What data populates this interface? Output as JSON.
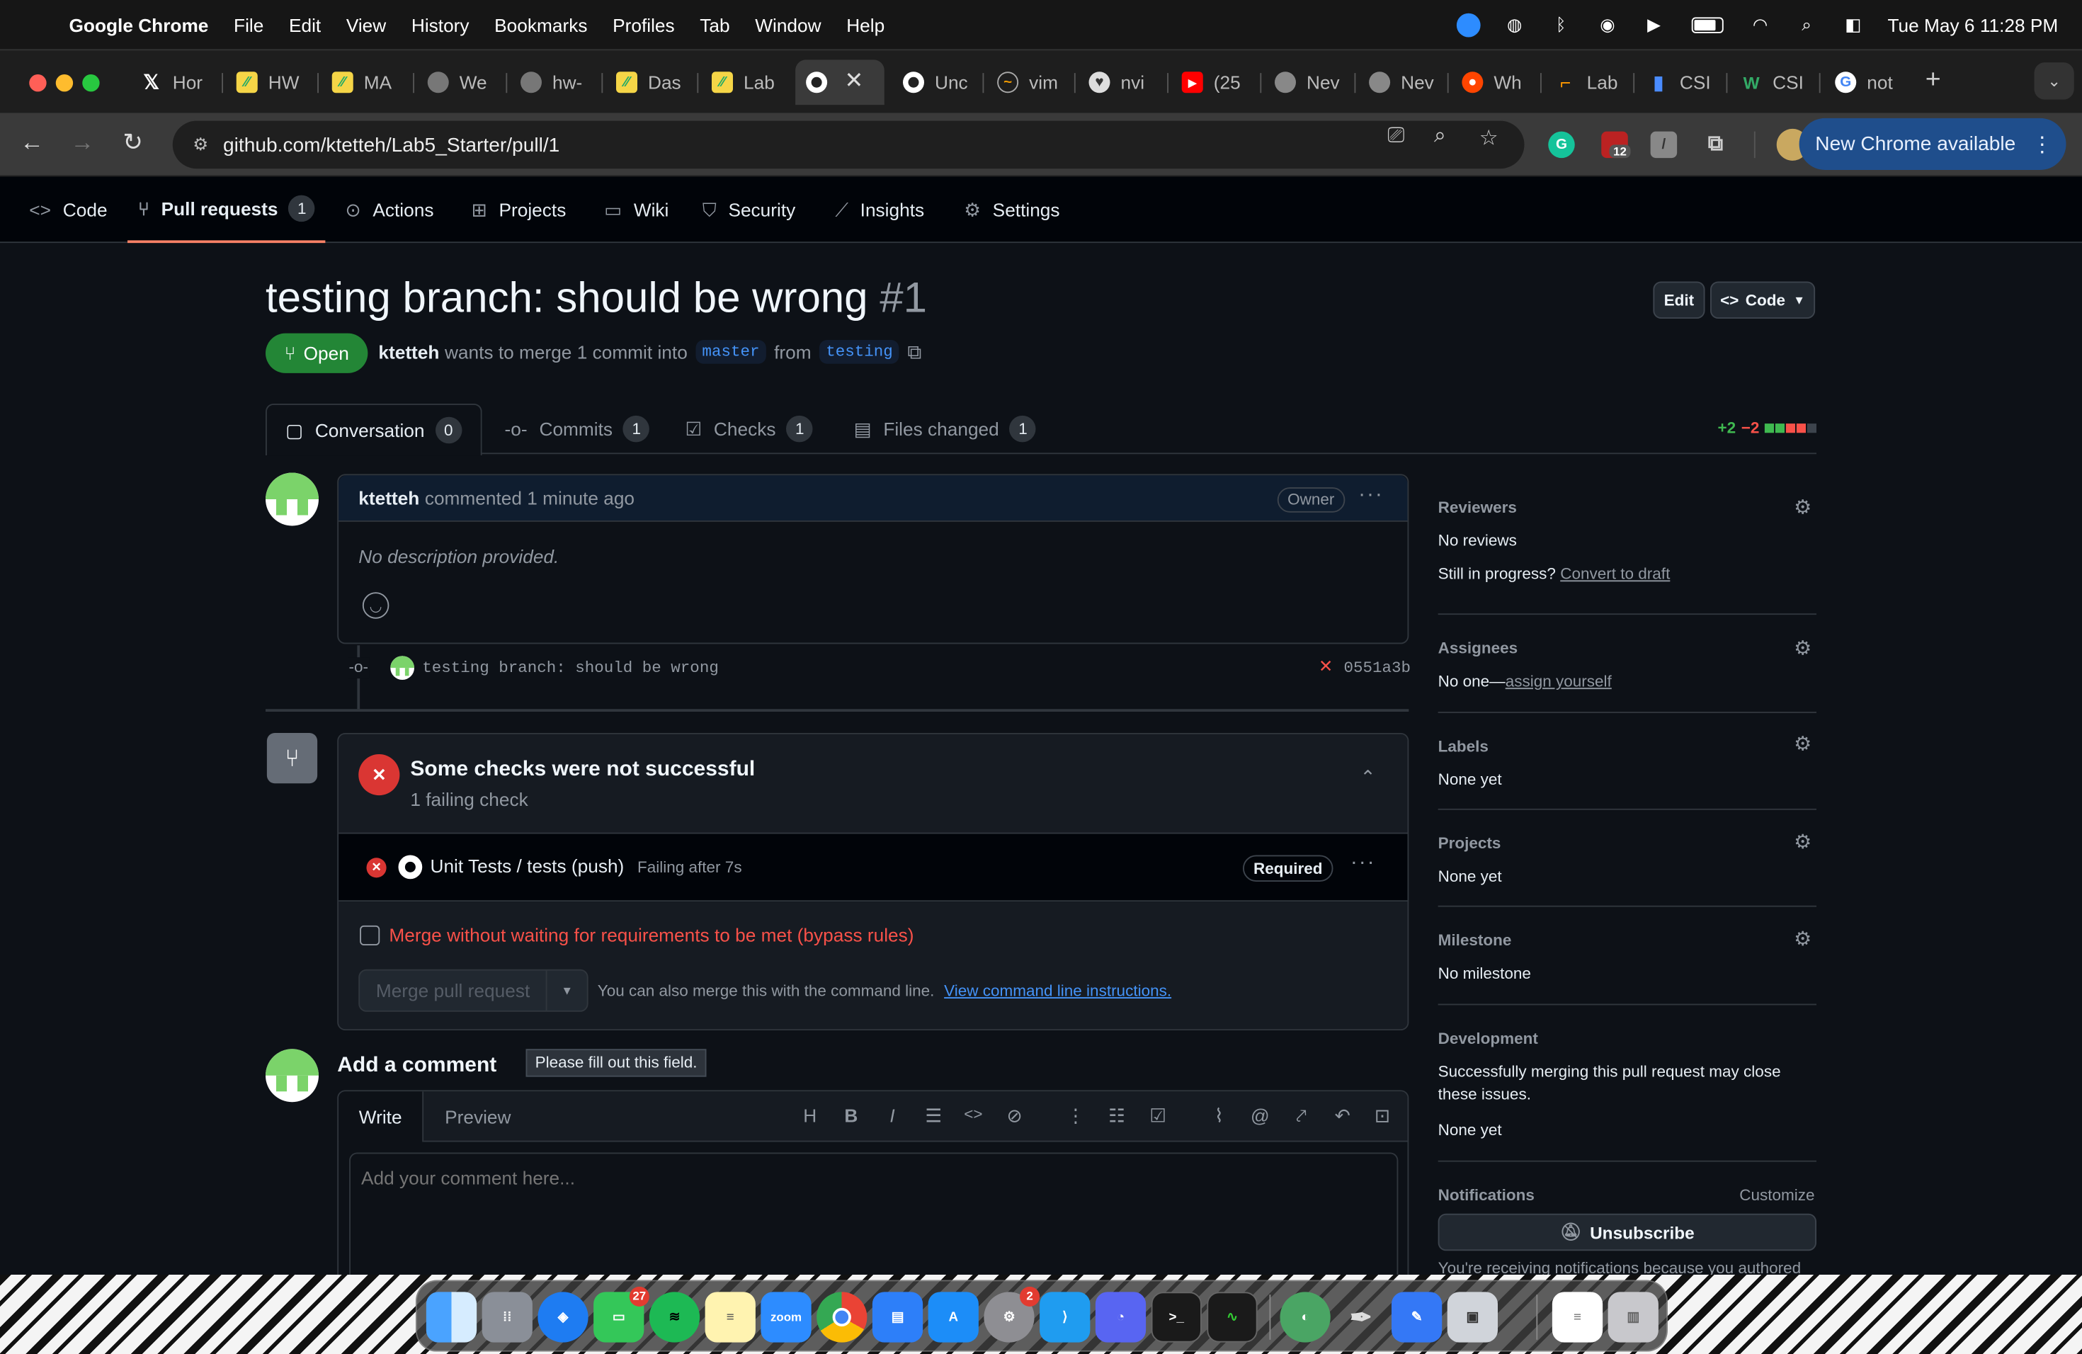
{
  "menubar": {
    "app_name": "Google Chrome",
    "items": [
      "File",
      "Edit",
      "View",
      "History",
      "Bookmarks",
      "Profiles",
      "Tab",
      "Window",
      "Help"
    ],
    "clock": "Tue May 6  11:28 PM",
    "status_icons": [
      "zoom-icon",
      "vpn-icon",
      "bluetooth-icon",
      "airdrop-icon",
      "play-icon",
      "battery-icon",
      "wifi-icon",
      "spotlight-icon",
      "control-center-icon"
    ]
  },
  "tabs": [
    {
      "title": "Hor",
      "icon": "x-icon"
    },
    {
      "title": "HW",
      "icon": "gradescope-icon"
    },
    {
      "title": "MA",
      "icon": "gradescope-icon"
    },
    {
      "title": "We",
      "icon": "globe-icon"
    },
    {
      "title": "hw-",
      "icon": "globe-icon"
    },
    {
      "title": "Das",
      "icon": "gradescope-icon"
    },
    {
      "title": "Lab",
      "icon": "gradescope-icon"
    },
    {
      "title": "",
      "icon": "github-icon",
      "active": true
    },
    {
      "title": "Unc",
      "icon": "github-icon"
    },
    {
      "title": "vim",
      "icon": "vim-icon"
    },
    {
      "title": "nvi",
      "icon": "neovim-icon"
    },
    {
      "title": "(25",
      "icon": "youtube-icon"
    },
    {
      "title": "Nev",
      "icon": "chrome-icon"
    },
    {
      "title": "Nev",
      "icon": "chrome-icon"
    },
    {
      "title": "Wh",
      "icon": "reddit-icon"
    },
    {
      "title": "Lab",
      "icon": "lab-icon"
    },
    {
      "title": "CSI",
      "icon": "chart-icon"
    },
    {
      "title": "CSI",
      "icon": "wiki-icon"
    },
    {
      "title": "not",
      "icon": "google-icon"
    }
  ],
  "toolbar": {
    "url": "github.com/ktetteh/Lab5_Starter/pull/1",
    "extension_badge": "12",
    "new_chrome_label": "New Chrome available"
  },
  "repo_nav": {
    "items": [
      {
        "label": "Code",
        "icon": "code-icon"
      },
      {
        "label": "Pull requests",
        "icon": "pull-request-icon",
        "count": "1"
      },
      {
        "label": "Actions",
        "icon": "play-icon"
      },
      {
        "label": "Projects",
        "icon": "table-icon"
      },
      {
        "label": "Wiki",
        "icon": "book-icon"
      },
      {
        "label": "Security",
        "icon": "shield-icon"
      },
      {
        "label": "Insights",
        "icon": "graph-icon"
      },
      {
        "label": "Settings",
        "icon": "gear-icon"
      }
    ]
  },
  "pr": {
    "title": "testing branch: should be wrong",
    "number": "#1",
    "edit_label": "Edit",
    "code_label": "Code",
    "state": "Open",
    "author": "ktetteh",
    "merge_text_1": "wants to merge 1 commit into",
    "base_branch": "master",
    "merge_text_2": "from",
    "head_branch": "testing",
    "diff_add": "+2",
    "diff_del": "−2"
  },
  "pr_tabs": [
    {
      "label": "Conversation",
      "count": "0",
      "icon": "comment-icon"
    },
    {
      "label": "Commits",
      "count": "1",
      "icon": "commit-icon"
    },
    {
      "label": "Checks",
      "count": "1",
      "icon": "checklist-icon"
    },
    {
      "label": "Files changed",
      "count": "1",
      "icon": "file-diff-icon"
    }
  ],
  "comment": {
    "author": "ktetteh",
    "meta": "commented 1 minute ago",
    "badge": "Owner",
    "body": "No description provided."
  },
  "commit": {
    "message": "testing branch: should be wrong",
    "sha": "0551a3b"
  },
  "checks": {
    "title": "Some checks were not successful",
    "subtitle": "1 failing check",
    "check_name": "Unit Tests / tests (push)",
    "check_status": "Failing after 7s",
    "required_label": "Required",
    "bypass_label": "Merge without waiting for requirements to be met (bypass rules)",
    "merge_button": "Merge pull request",
    "cli_text": "You can also merge this with the command line.",
    "cli_link": "View command line instructions."
  },
  "add_comment": {
    "heading": "Add a comment",
    "tooltip": "Please fill out this field.",
    "write_tab": "Write",
    "preview_tab": "Preview",
    "placeholder": "Add your comment here..."
  },
  "sidebar": {
    "reviewers_head": "Reviewers",
    "reviewers_value": "No reviews",
    "draft_text": "Still in progress?",
    "draft_link": "Convert to draft",
    "assignees_head": "Assignees",
    "assignees_value": "No one—",
    "assignees_link": "assign yourself",
    "labels_head": "Labels",
    "labels_value": "None yet",
    "projects_head": "Projects",
    "projects_value": "None yet",
    "milestone_head": "Milestone",
    "milestone_value": "No milestone",
    "development_head": "Development",
    "development_text_1": "Successfully merging this pull request may close",
    "development_text_2": "these issues.",
    "development_value": "None yet",
    "notifications_head": "Notifications",
    "customize_label": "Customize",
    "unsubscribe_label": "Unsubscribe",
    "notification_reason": "You're receiving notifications because you authored"
  },
  "dock": {
    "apps": [
      "finder",
      "launchpad",
      "safari",
      "messages",
      "spotify",
      "notes",
      "zoom",
      "chrome",
      "keynote",
      "app-store",
      "system-settings",
      "vscode",
      "discord",
      "terminal",
      "activity-monitor",
      "world-clock",
      "inkscape",
      "pen-tool",
      "preview",
      "document",
      "trash"
    ],
    "messages_badge": "27",
    "settings_badge": "2",
    "zoom_label": "zoom"
  }
}
